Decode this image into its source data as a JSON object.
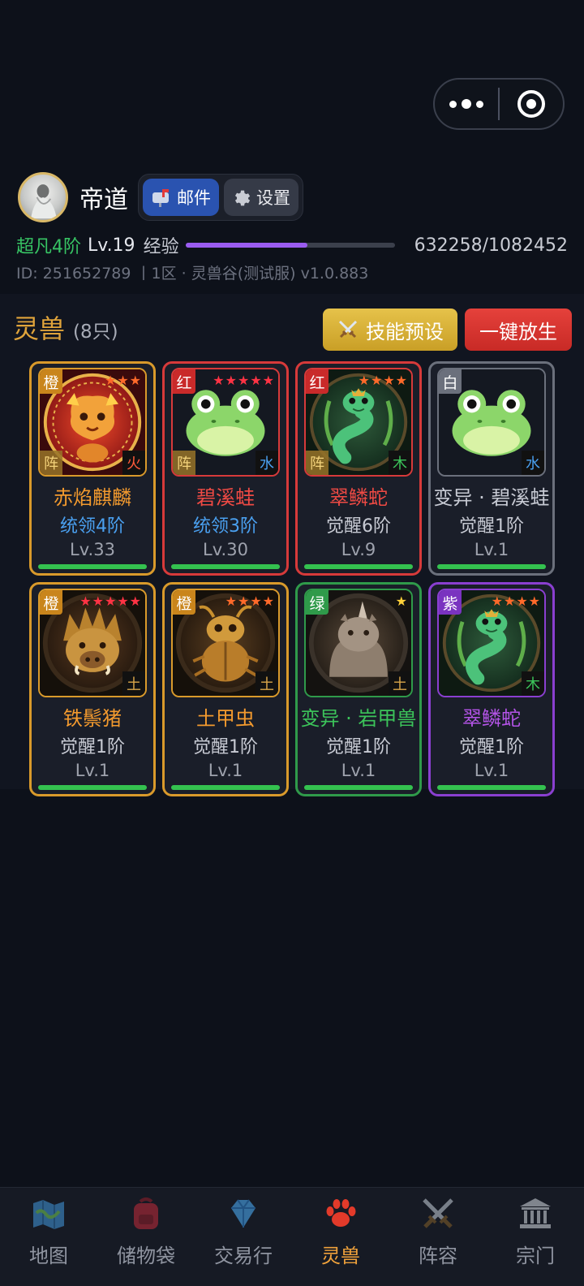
{
  "header": {
    "username": "帝道",
    "mail_label": "邮件",
    "settings_label": "设置"
  },
  "status": {
    "rank": "超凡4阶",
    "level": "Lv.19",
    "exp_label": "经验",
    "exp_text": "632258/1082452",
    "exp_fraction": 0.584,
    "id_line": "ID: 251652789 丨1区 · 灵兽谷(测试服)  v1.0.883"
  },
  "section": {
    "title": "灵兽",
    "count": "(8只)",
    "skill_preset_label": "技能预设",
    "release_all_label": "一键放生"
  },
  "beasts": [
    {
      "quality": "橙",
      "stars": "★★★",
      "formation": "阵",
      "element": "火",
      "name": "赤焰麒麟",
      "sub": "统领4阶",
      "level": "Lv.33",
      "hp": 1.0,
      "border": "#d99a2b",
      "tag_color": "#c9851c",
      "star_color": "#ff6a2a",
      "name_color": "#f39a2e",
      "sub_color": "#4aa0f0",
      "elem_color": "#ff5a3a",
      "art": "qilin"
    },
    {
      "quality": "红",
      "stars": "★★★★★",
      "formation": "阵",
      "element": "水",
      "name": "碧溪蛙",
      "sub": "统领3阶",
      "level": "Lv.30",
      "hp": 1.0,
      "border": "#d73a3a",
      "tag_color": "#c92a2a",
      "star_color": "#ff3344",
      "name_color": "#ef4a44",
      "sub_color": "#4aa0f0",
      "elem_color": "#4aa0f0",
      "art": "frog"
    },
    {
      "quality": "红",
      "stars": "★★★★",
      "formation": "阵",
      "element": "木",
      "name": "翠鳞蛇",
      "sub": "觉醒6阶",
      "level": "Lv.9",
      "hp": 1.0,
      "border": "#d73a3a",
      "tag_color": "#c92a2a",
      "star_color": "#ff6a2a",
      "name_color": "#ef4a44",
      "sub_color": "#c7cad3",
      "elem_color": "#3cc45a",
      "art": "snake"
    },
    {
      "quality": "白",
      "stars": "",
      "formation": "",
      "element": "水",
      "name": "变异 · 碧溪蛙",
      "sub": "觉醒1阶",
      "level": "Lv.1",
      "hp": 1.0,
      "border": "#6b707c",
      "tag_color": "#6b707c",
      "star_color": "#ffffff",
      "name_color": "#c7cad3",
      "sub_color": "#c7cad3",
      "elem_color": "#4aa0f0",
      "art": "frog"
    },
    {
      "quality": "橙",
      "stars": "★★★★★",
      "formation": "",
      "element": "土",
      "name": "铁鬃猪",
      "sub": "觉醒1阶",
      "level": "Lv.1",
      "hp": 1.0,
      "border": "#d99a2b",
      "tag_color": "#c9851c",
      "star_color": "#ff3344",
      "name_color": "#f39a2e",
      "sub_color": "#c7cad3",
      "elem_color": "#d9a64a",
      "art": "boar"
    },
    {
      "quality": "橙",
      "stars": "★★★★",
      "formation": "",
      "element": "土",
      "name": "土甲虫",
      "sub": "觉醒1阶",
      "level": "Lv.1",
      "hp": 1.0,
      "border": "#d99a2b",
      "tag_color": "#c9851c",
      "star_color": "#ff6a2a",
      "name_color": "#f39a2e",
      "sub_color": "#c7cad3",
      "elem_color": "#d9a64a",
      "art": "beetle"
    },
    {
      "quality": "绿",
      "stars": "★",
      "formation": "",
      "element": "土",
      "name": "变异 · 岩甲兽",
      "sub": "觉醒1阶",
      "level": "Lv.1",
      "hp": 1.0,
      "border": "#2f9a4a",
      "tag_color": "#2f9a4a",
      "star_color": "#ffd23a",
      "name_color": "#3cc45a",
      "sub_color": "#c7cad3",
      "elem_color": "#d9a64a",
      "art": "rhino"
    },
    {
      "quality": "紫",
      "stars": "★★★★",
      "formation": "",
      "element": "木",
      "name": "翠鳞蛇",
      "sub": "觉醒1阶",
      "level": "Lv.1",
      "hp": 1.0,
      "border": "#8a3fd0",
      "tag_color": "#7a33c0",
      "star_color": "#ff6a2a",
      "name_color": "#b454e8",
      "sub_color": "#c7cad3",
      "elem_color": "#3cc45a",
      "art": "snake"
    }
  ],
  "tabs": [
    {
      "label": "地图",
      "icon": "map-icon"
    },
    {
      "label": "储物袋",
      "icon": "backpack-icon"
    },
    {
      "label": "交易行",
      "icon": "diamond-icon"
    },
    {
      "label": "灵兽",
      "icon": "paw-icon",
      "active": true
    },
    {
      "label": "阵容",
      "icon": "crossed-swords-icon"
    },
    {
      "label": "宗门",
      "icon": "temple-icon"
    }
  ]
}
